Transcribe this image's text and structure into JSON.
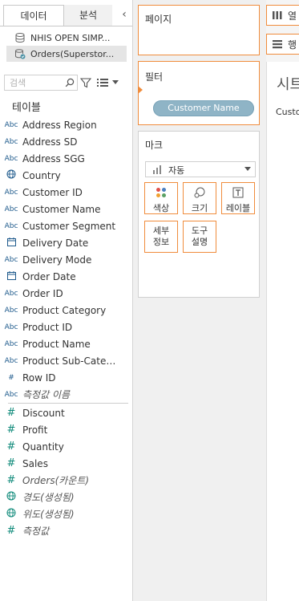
{
  "data_pane": {
    "tabs": [
      {
        "label": "데이터",
        "active": true
      },
      {
        "label": "분석",
        "active": false
      }
    ],
    "collapse_icon": "chevron-left",
    "datasources": [
      {
        "label": "NHIS OPEN SIMP...",
        "icon": "database-icon",
        "selected": false
      },
      {
        "label": "Orders(Superstor...",
        "icon": "database-linked-icon",
        "selected": true
      }
    ],
    "search": {
      "placeholder": "검색",
      "value": ""
    },
    "tables_title": "테이블",
    "dimensions": [
      {
        "type": "Abc",
        "label": "Address Region"
      },
      {
        "type": "Abc",
        "label": "Address SD"
      },
      {
        "type": "Abc",
        "label": "Address SGG"
      },
      {
        "type": "globe",
        "label": "Country"
      },
      {
        "type": "Abc",
        "label": "Customer ID"
      },
      {
        "type": "Abc",
        "label": "Customer Name"
      },
      {
        "type": "Abc",
        "label": "Customer Segment"
      },
      {
        "type": "date",
        "label": "Delivery Date"
      },
      {
        "type": "Abc",
        "label": "Delivery Mode"
      },
      {
        "type": "date",
        "label": "Order Date"
      },
      {
        "type": "Abc",
        "label": "Order ID"
      },
      {
        "type": "Abc",
        "label": "Product Category"
      },
      {
        "type": "Abc",
        "label": "Product ID"
      },
      {
        "type": "Abc",
        "label": "Product Name"
      },
      {
        "type": "Abc",
        "label": "Product Sub-Categ..."
      },
      {
        "type": "#",
        "label": "Row ID"
      },
      {
        "type": "Abc",
        "label": "측정값 이름",
        "italic": true
      }
    ],
    "measures": [
      {
        "type": "#",
        "label": "Discount"
      },
      {
        "type": "#",
        "label": "Profit"
      },
      {
        "type": "#",
        "label": "Quantity"
      },
      {
        "type": "#",
        "label": "Sales"
      },
      {
        "type": "#",
        "label": "Orders(카운트)",
        "italic": true
      },
      {
        "type": "globe",
        "label": "경도(생성됨)",
        "italic": true
      },
      {
        "type": "globe",
        "label": "위도(생성됨)",
        "italic": true
      },
      {
        "type": "#",
        "label": "측정값",
        "italic": true
      }
    ]
  },
  "shelves": {
    "pages_title": "페이지",
    "filters_title": "필터",
    "filter_pill": "Customer Name",
    "marks_title": "마크",
    "mark_type": "자동",
    "mark_buttons": [
      {
        "label": "색상",
        "icon": "color-dots-icon"
      },
      {
        "label": "크기",
        "icon": "size-icon"
      },
      {
        "label": "레이블",
        "icon": "label-icon"
      },
      {
        "label": "세부\n정보",
        "icon": "detail-icon"
      },
      {
        "label": "도구\n설명",
        "icon": "tooltip-icon"
      }
    ]
  },
  "view": {
    "columns_label": "열",
    "rows_label": "행",
    "sheet_title": "시트",
    "header_text": "Custo"
  },
  "colors": {
    "accent_orange": "#f08c3c",
    "pill_blue": "#8fb4c6",
    "dimension_blue": "#1e5a8c",
    "measure_teal": "#0f8a7a"
  }
}
